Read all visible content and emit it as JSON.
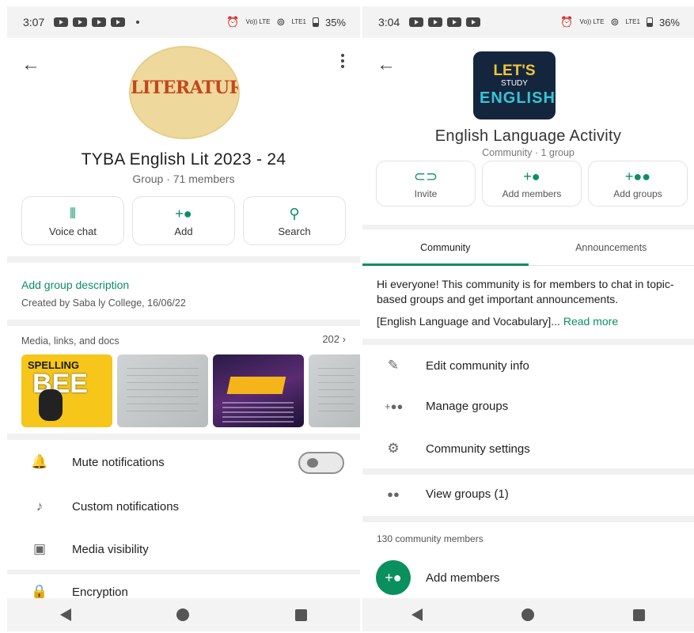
{
  "left": {
    "status": {
      "time": "3:07",
      "battery": "35%",
      "volte": "Vo)) LTE",
      "lte": "LTE1"
    },
    "avatar_text": "LITERATURE",
    "group_name": "TYBA English Lit 2023 - 24",
    "group_meta": "Group · 71 members",
    "actions": [
      {
        "icon": "voice-chat-icon",
        "label": "Voice chat"
      },
      {
        "icon": "add-person-icon",
        "label": "Add"
      },
      {
        "icon": "search-icon",
        "label": "Search"
      }
    ],
    "add_description": "Add group description",
    "created_by": "Created by Saba ly College, 16/06/22",
    "media_label": "Media, links, and docs",
    "media_count": "202",
    "media_bee_top": "SPELLING",
    "media_bee_main": "BEE",
    "settings": [
      {
        "icon": "bell-icon",
        "label": "Mute notifications"
      },
      {
        "icon": "music-note-icon",
        "label": "Custom notifications"
      },
      {
        "icon": "image-icon",
        "label": "Media visibility"
      },
      {
        "icon": "lock-icon",
        "label": "Encryption"
      }
    ],
    "mute_enabled": false
  },
  "right": {
    "status": {
      "time": "3:04",
      "battery": "36%",
      "volte": "Vo)) LTE",
      "lte": "LTE1"
    },
    "avatar_line1": "LET'S",
    "avatar_line2": "STUDY",
    "avatar_line3": "ENGLISH",
    "community_name": "English Language Activity",
    "community_meta": "Community · 1 group",
    "actions": [
      {
        "icon": "link-icon",
        "label": "Invite"
      },
      {
        "icon": "add-person-icon",
        "label": "Add members"
      },
      {
        "icon": "add-group-icon",
        "label": "Add groups"
      }
    ],
    "tabs": [
      "Community",
      "Announcements"
    ],
    "active_tab": "Community",
    "description": "Hi everyone! This community is for members to chat in topic-based groups and get important announcements.",
    "description_more": "[English Language and Vocabulary]...",
    "read_more": "Read more",
    "menu": [
      {
        "icon": "pencil-icon",
        "label": "Edit community info"
      },
      {
        "icon": "manage-groups-icon",
        "label": "Manage groups"
      },
      {
        "icon": "gear-icon",
        "label": "Community settings"
      }
    ],
    "view_groups": "View groups (1)",
    "members_count": "130 community members",
    "add_members": "Add members"
  },
  "colors": {
    "accent": "#0a8f5f"
  }
}
